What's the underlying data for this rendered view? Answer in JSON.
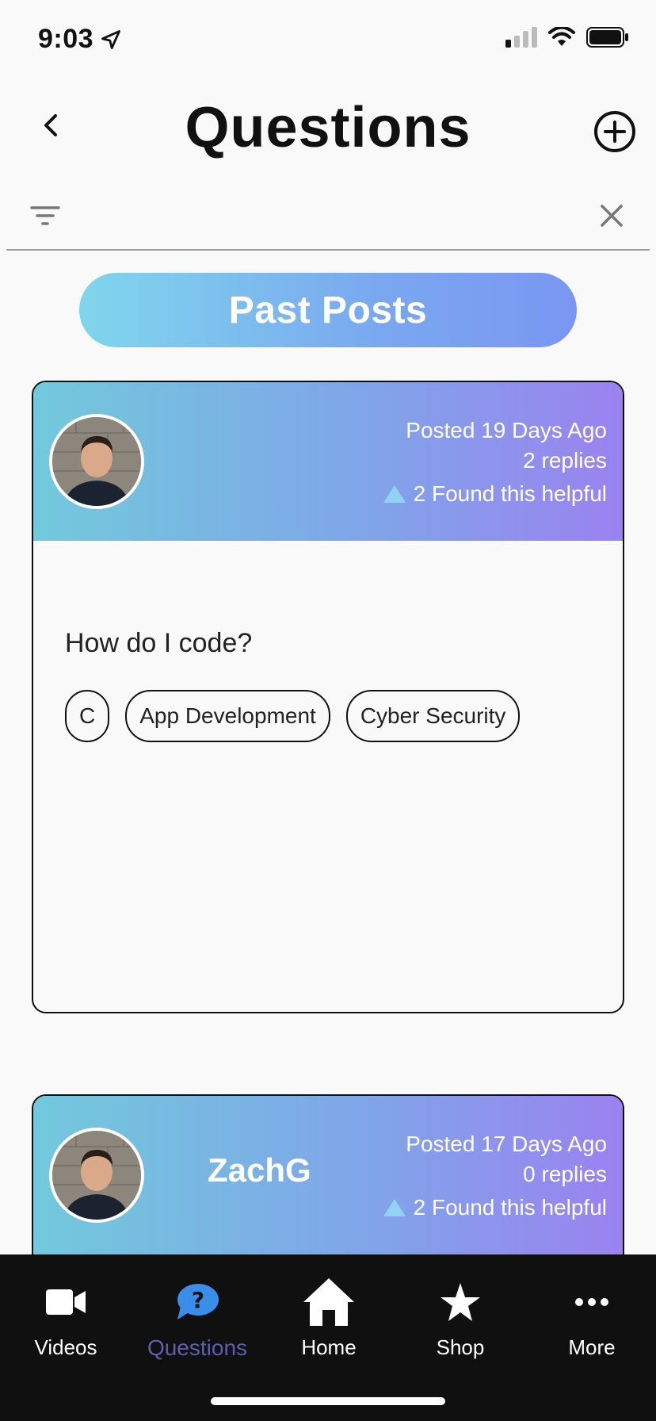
{
  "status_bar": {
    "time": "9:03"
  },
  "header": {
    "title": "Questions"
  },
  "past_posts_label": "Past Posts",
  "posts": [
    {
      "username": "",
      "posted": "Posted 19 Days Ago",
      "replies": "2 replies",
      "helpful": "2 Found this helpful",
      "question": "How do I code?",
      "tags": [
        "C",
        "App Development",
        "Cyber Security"
      ]
    },
    {
      "username": "ZachG",
      "posted": "Posted 17 Days Ago",
      "replies": "0 replies",
      "helpful": "2 Found this helpful"
    }
  ],
  "tabs": [
    {
      "label": "Videos",
      "icon": "video-camera-icon",
      "active": false
    },
    {
      "label": "Questions",
      "icon": "question-bubble-icon",
      "active": true
    },
    {
      "label": "Home",
      "icon": "home-icon",
      "active": false
    },
    {
      "label": "Shop",
      "icon": "star-icon",
      "active": false
    },
    {
      "label": "More",
      "icon": "more-dots-icon",
      "active": false
    }
  ],
  "colors": {
    "accent_active_tab": "#5b5fb0",
    "tab_bar_bg": "#101011",
    "helpful_triangle": "#8fd3f0"
  }
}
